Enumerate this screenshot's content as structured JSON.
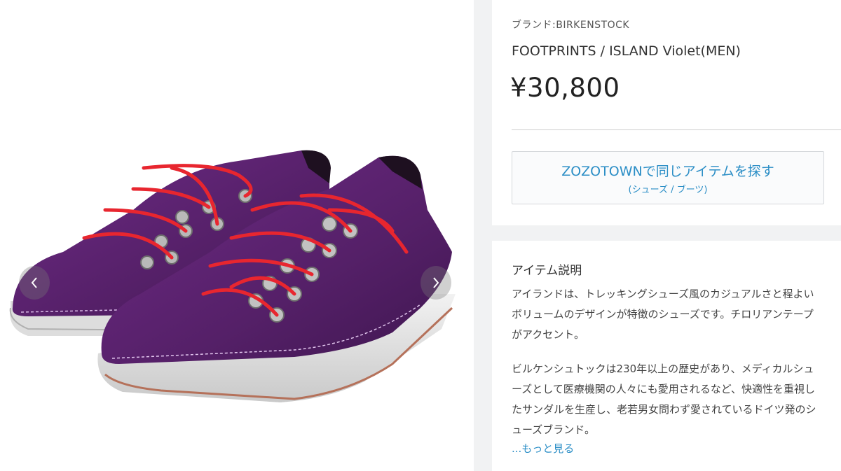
{
  "product": {
    "brand_label": "ブランド:BIRKENSTOCK",
    "name": "FOOTPRINTS / ISLAND Violet(MEN)",
    "price": "¥30,800"
  },
  "zozo_button": {
    "label": "ZOZOTOWNで同じアイテムを探す",
    "sublabel": "(シューズ / ブーツ)"
  },
  "description": {
    "heading": "アイテム説明",
    "paragraph1": "アイランドは、トレッキングシューズ風のカジュアルさと程よいボリュームのデザインが特徴のシューズです。チロリアンテープがアクセント。",
    "paragraph2": "ビルケンシュトックは230年以上の歴史があり、メディカルシューズとして医療機関の人々にも愛用されるなど、快適性を重視したサンダルを生産し、老若男女問わず愛されているドイツ発のシューズブランド。",
    "more_link": "...もっと見る"
  },
  "gallery": {
    "prev_icon": "chevron-left-icon",
    "next_icon": "chevron-right-icon"
  },
  "colors": {
    "link": "#2b8ec6",
    "shoe_suede": "#5a1f6e",
    "laces": "#e8262f"
  }
}
